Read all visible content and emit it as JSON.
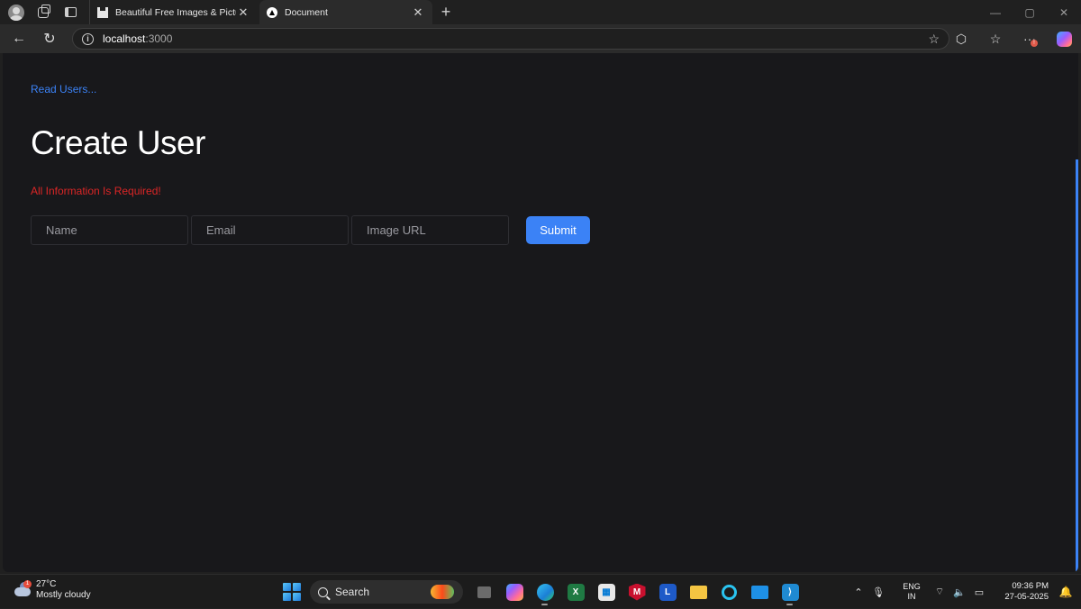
{
  "browser": {
    "tabs": [
      {
        "title": "Beautiful Free Images & Pictures |",
        "active": false
      },
      {
        "title": "Document",
        "active": true
      }
    ],
    "new_tab": "+",
    "url": {
      "host": "localhost",
      "port": ":3000"
    }
  },
  "page": {
    "read_users_link": "Read Users...",
    "title": "Create User",
    "error": "All Information Is Required!",
    "fields": {
      "name_placeholder": "Name",
      "email_placeholder": "Email",
      "image_url_placeholder": "Image URL"
    },
    "submit_label": "Submit"
  },
  "taskbar": {
    "weather": {
      "temp": "27°C",
      "condition": "Mostly cloudy",
      "badge": "1"
    },
    "search_label": "Search",
    "lang": {
      "line1": "ENG",
      "line2": "IN"
    },
    "clock": {
      "time": "09:36 PM",
      "date": "27-05-2025"
    }
  },
  "colors": {
    "accent": "#3b82f6",
    "error": "#dc2626",
    "page_bg": "#18181b"
  }
}
